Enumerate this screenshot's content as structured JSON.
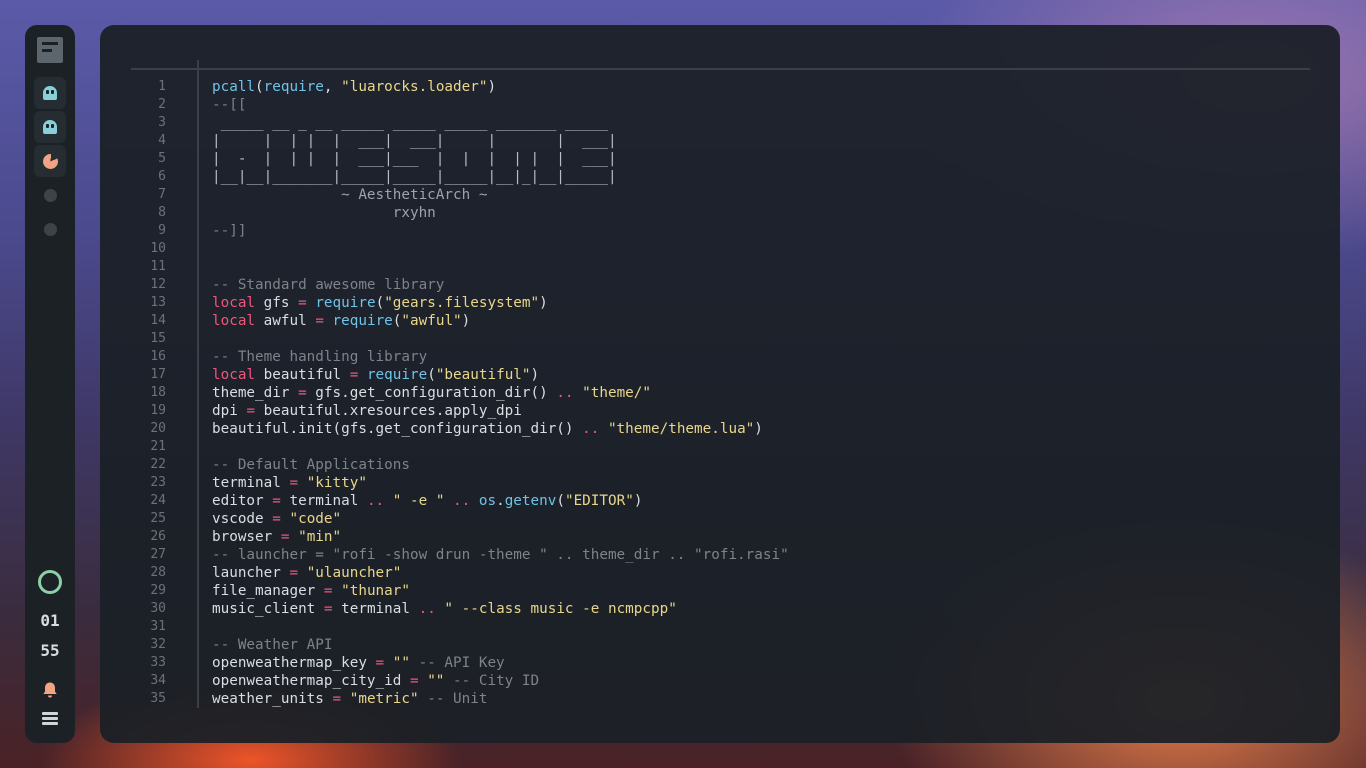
{
  "dock": {
    "workspaces": [
      "ghost-icon",
      "ghost-icon",
      "pacman-icon",
      "dot-icon",
      "dot-icon"
    ],
    "clock_hour": "01",
    "clock_minute": "55"
  },
  "editor": {
    "lines": [
      {
        "n": "1",
        "parts": [
          [
            "fn",
            "pcall"
          ],
          [
            "tx",
            "("
          ],
          [
            "fn",
            "require"
          ],
          [
            "tx",
            ", "
          ],
          [
            "st",
            "\"luarocks.loader\""
          ],
          [
            "tx",
            ")"
          ]
        ]
      },
      {
        "n": "2",
        "parts": [
          [
            "cm",
            "--[["
          ]
        ]
      },
      {
        "n": "3",
        "parts": [
          [
            "ascii",
            " _____ __ _ __ _____ _____ _____ _______ _____"
          ]
        ]
      },
      {
        "n": "4",
        "parts": [
          [
            "ascii",
            "|     |  | |  |  ___|  ___|     |       |  ___|"
          ]
        ]
      },
      {
        "n": "5",
        "parts": [
          [
            "ascii",
            "|  -  |  | |  |  ___|___  |  |  |  | |  |  ___|"
          ]
        ]
      },
      {
        "n": "6",
        "parts": [
          [
            "ascii",
            "|__|__|_______|_____|_____|_____|__|_|__|_____|"
          ]
        ]
      },
      {
        "n": "7",
        "parts": [
          [
            "ascii2",
            "               ~ AestheticArch ~"
          ]
        ]
      },
      {
        "n": "8",
        "parts": [
          [
            "ascii2",
            "                     rxyhn"
          ]
        ]
      },
      {
        "n": "9",
        "parts": [
          [
            "cm",
            "--]]"
          ]
        ]
      },
      {
        "n": "10",
        "parts": []
      },
      {
        "n": "11",
        "parts": []
      },
      {
        "n": "12",
        "parts": [
          [
            "cm",
            "-- Standard awesome library"
          ]
        ]
      },
      {
        "n": "13",
        "parts": [
          [
            "kw",
            "local"
          ],
          [
            "tx",
            " gfs "
          ],
          [
            "op",
            "="
          ],
          [
            "tx",
            " "
          ],
          [
            "fn",
            "require"
          ],
          [
            "tx",
            "("
          ],
          [
            "st",
            "\"gears.filesystem\""
          ],
          [
            "tx",
            ")"
          ]
        ]
      },
      {
        "n": "14",
        "parts": [
          [
            "kw",
            "local"
          ],
          [
            "tx",
            " awful "
          ],
          [
            "op",
            "="
          ],
          [
            "tx",
            " "
          ],
          [
            "fn",
            "require"
          ],
          [
            "tx",
            "("
          ],
          [
            "st",
            "\"awful\""
          ],
          [
            "tx",
            ")"
          ]
        ]
      },
      {
        "n": "15",
        "parts": []
      },
      {
        "n": "16",
        "parts": [
          [
            "cm",
            "-- Theme handling library"
          ]
        ]
      },
      {
        "n": "17",
        "parts": [
          [
            "kw",
            "local"
          ],
          [
            "tx",
            " beautiful "
          ],
          [
            "op",
            "="
          ],
          [
            "tx",
            " "
          ],
          [
            "fn",
            "require"
          ],
          [
            "tx",
            "("
          ],
          [
            "st",
            "\"beautiful\""
          ],
          [
            "tx",
            ")"
          ]
        ]
      },
      {
        "n": "18",
        "parts": [
          [
            "tx",
            "theme_dir "
          ],
          [
            "op",
            "="
          ],
          [
            "tx",
            " gfs.get_configuration_dir() "
          ],
          [
            "op",
            ".."
          ],
          [
            "tx",
            " "
          ],
          [
            "st",
            "\"theme/\""
          ]
        ]
      },
      {
        "n": "19",
        "parts": [
          [
            "tx",
            "dpi "
          ],
          [
            "op",
            "="
          ],
          [
            "tx",
            " beautiful.xresources.apply_dpi"
          ]
        ]
      },
      {
        "n": "20",
        "parts": [
          [
            "tx",
            "beautiful.init(gfs.get_configuration_dir() "
          ],
          [
            "op",
            ".."
          ],
          [
            "tx",
            " "
          ],
          [
            "st",
            "\"theme/theme.lua\""
          ],
          [
            "tx",
            ")"
          ]
        ]
      },
      {
        "n": "21",
        "parts": []
      },
      {
        "n": "22",
        "parts": [
          [
            "cm",
            "-- Default Applications"
          ]
        ]
      },
      {
        "n": "23",
        "parts": [
          [
            "tx",
            "terminal "
          ],
          [
            "op",
            "="
          ],
          [
            "tx",
            " "
          ],
          [
            "st",
            "\"kitty\""
          ]
        ]
      },
      {
        "n": "24",
        "parts": [
          [
            "tx",
            "editor "
          ],
          [
            "op",
            "="
          ],
          [
            "tx",
            " terminal "
          ],
          [
            "op",
            ".."
          ],
          [
            "tx",
            " "
          ],
          [
            "st",
            "\" -e \""
          ],
          [
            "tx",
            " "
          ],
          [
            "op",
            ".."
          ],
          [
            "tx",
            " "
          ],
          [
            "fn",
            "os"
          ],
          [
            "tx",
            "."
          ],
          [
            "fn",
            "getenv"
          ],
          [
            "tx",
            "("
          ],
          [
            "st",
            "\"EDITOR\""
          ],
          [
            "tx",
            ")"
          ]
        ]
      },
      {
        "n": "25",
        "parts": [
          [
            "tx",
            "vscode "
          ],
          [
            "op",
            "="
          ],
          [
            "tx",
            " "
          ],
          [
            "st",
            "\"code\""
          ]
        ]
      },
      {
        "n": "26",
        "parts": [
          [
            "tx",
            "browser "
          ],
          [
            "op",
            "="
          ],
          [
            "tx",
            " "
          ],
          [
            "st",
            "\"min\""
          ]
        ]
      },
      {
        "n": "27",
        "parts": [
          [
            "cm",
            "-- launcher = \"rofi -show drun -theme \" .. theme_dir .. \"rofi.rasi\""
          ]
        ]
      },
      {
        "n": "28",
        "parts": [
          [
            "tx",
            "launcher "
          ],
          [
            "op",
            "="
          ],
          [
            "tx",
            " "
          ],
          [
            "st",
            "\"ulauncher\""
          ]
        ]
      },
      {
        "n": "29",
        "parts": [
          [
            "tx",
            "file_manager "
          ],
          [
            "op",
            "="
          ],
          [
            "tx",
            " "
          ],
          [
            "st",
            "\"thunar\""
          ]
        ]
      },
      {
        "n": "30",
        "parts": [
          [
            "tx",
            "music_client "
          ],
          [
            "op",
            "="
          ],
          [
            "tx",
            " terminal "
          ],
          [
            "op",
            ".."
          ],
          [
            "tx",
            " "
          ],
          [
            "st",
            "\" --class music -e ncmpcpp\""
          ]
        ]
      },
      {
        "n": "31",
        "parts": []
      },
      {
        "n": "32",
        "parts": [
          [
            "cm",
            "-- Weather API"
          ]
        ]
      },
      {
        "n": "33",
        "parts": [
          [
            "tx",
            "openweathermap_key "
          ],
          [
            "op",
            "="
          ],
          [
            "tx",
            " "
          ],
          [
            "st",
            "\"\""
          ],
          [
            "tx",
            " "
          ],
          [
            "cm",
            "-- API Key"
          ]
        ]
      },
      {
        "n": "34",
        "parts": [
          [
            "tx",
            "openweathermap_city_id "
          ],
          [
            "op",
            "="
          ],
          [
            "tx",
            " "
          ],
          [
            "st",
            "\"\""
          ],
          [
            "tx",
            " "
          ],
          [
            "cm",
            "-- City ID"
          ]
        ]
      },
      {
        "n": "35",
        "parts": [
          [
            "tx",
            "weather_units "
          ],
          [
            "op",
            "="
          ],
          [
            "tx",
            " "
          ],
          [
            "st",
            "\"metric\""
          ],
          [
            "tx",
            " "
          ],
          [
            "cm",
            "-- Unit"
          ]
        ]
      }
    ]
  }
}
